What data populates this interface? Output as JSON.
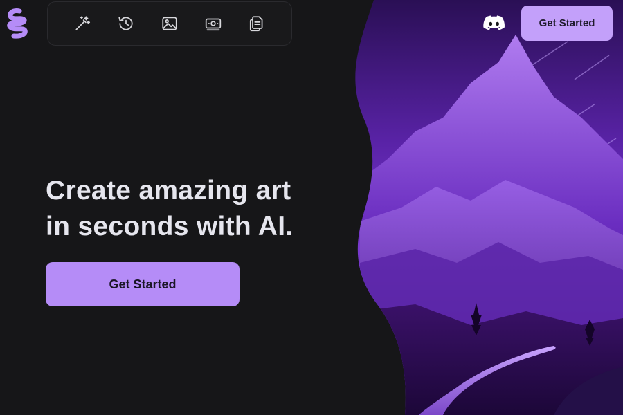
{
  "app": {
    "logo_icon": "squiggle-s-logo-icon",
    "brand_color": "#b58cf7"
  },
  "toolbar": {
    "items": [
      {
        "icon": "magic-wand-icon"
      },
      {
        "icon": "history-icon"
      },
      {
        "icon": "image-icon"
      },
      {
        "icon": "money-icon"
      },
      {
        "icon": "document-copy-icon"
      }
    ]
  },
  "hero": {
    "headline_line1": "Create amazing art",
    "headline_line2": "in seconds with AI.",
    "cta_label": "Get Started",
    "art_icon": "purple-mountain-landscape"
  },
  "header": {
    "discord_icon": "discord-icon",
    "cta_label": "Get Started"
  }
}
